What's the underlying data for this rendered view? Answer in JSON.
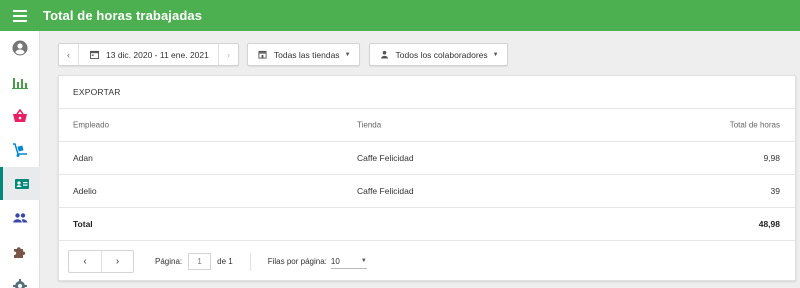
{
  "app": {
    "title": "Total de horas trabajadas"
  },
  "sidebar": {
    "items": [
      {
        "icon": "account-circle-icon"
      },
      {
        "icon": "bar-chart-icon"
      },
      {
        "icon": "basket-icon"
      },
      {
        "icon": "hand-truck-icon"
      },
      {
        "icon": "badge-icon",
        "active": true
      },
      {
        "icon": "people-icon"
      },
      {
        "icon": "puzzle-icon"
      },
      {
        "icon": "settings-icon"
      }
    ]
  },
  "toolbar": {
    "prev": "‹",
    "date_range": "13 dic. 2020 - 11 ene. 2021",
    "next": "›",
    "stores": "Todas las tiendas",
    "collaborators": "Todos los colaboradores"
  },
  "card": {
    "export_label": "EXPORTAR"
  },
  "table": {
    "headers": [
      "Empleado",
      "Tienda",
      "Total de horas"
    ],
    "rows": [
      [
        "Adan",
        "Caffe Felicidad",
        "9,98"
      ],
      [
        "Adelio",
        "Caffe Felicidad",
        "39"
      ]
    ],
    "total_label": "Total",
    "total_value": "48,98"
  },
  "pagination": {
    "prev": "‹",
    "next": "›",
    "page_label": "Página:",
    "page_value": "1",
    "page_of": "de 1",
    "rows_label": "Filas por página:",
    "rows_value": "10"
  },
  "colors": {
    "topbar": "#4caf50",
    "active_accent": "#00897b"
  }
}
